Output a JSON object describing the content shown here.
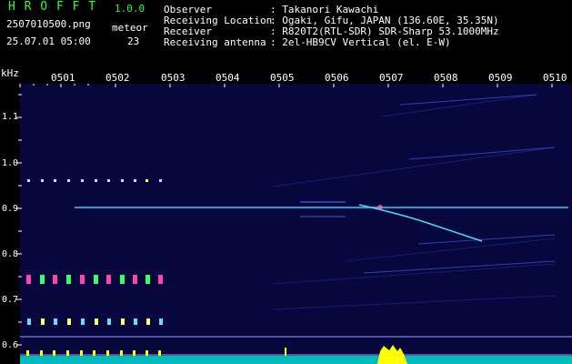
{
  "app": {
    "name": "H R O F F T",
    "version": "1.0.0",
    "filename": "2507010500.png",
    "datetime": "25.07.01 05:00",
    "meteor_label": "meteor",
    "meteor_count": "23"
  },
  "info": {
    "rows": [
      {
        "label": "Observer",
        "value": ": Takanori Kawachi"
      },
      {
        "label": "Receiving Location",
        "value": ": Ogaki, Gifu, JAPAN (136.60E, 35.35N)"
      },
      {
        "label": "Receiver",
        "value": ": R820T2(RTL-SDR) SDR-Sharp 53.1000MHz"
      },
      {
        "label": "Receiving antenna",
        "value": ": 2el-HB9CV Vertical (el. E-W)"
      }
    ]
  },
  "axis": {
    "unit": "kHz",
    "freq_labels": [
      "1.1",
      "1.0",
      "0.9",
      "0.8",
      "0.7",
      "0.6"
    ],
    "time_labels": [
      "0501",
      "0502",
      "0503",
      "0504",
      "0505",
      "0506",
      "0507",
      "0508",
      "0509",
      "0510"
    ]
  },
  "colors": {
    "background": "#05053a",
    "header_green": "#33ff33",
    "signal_line": "#33ccff",
    "power_bar": "#00cccc",
    "burst": "#ffff00"
  }
}
